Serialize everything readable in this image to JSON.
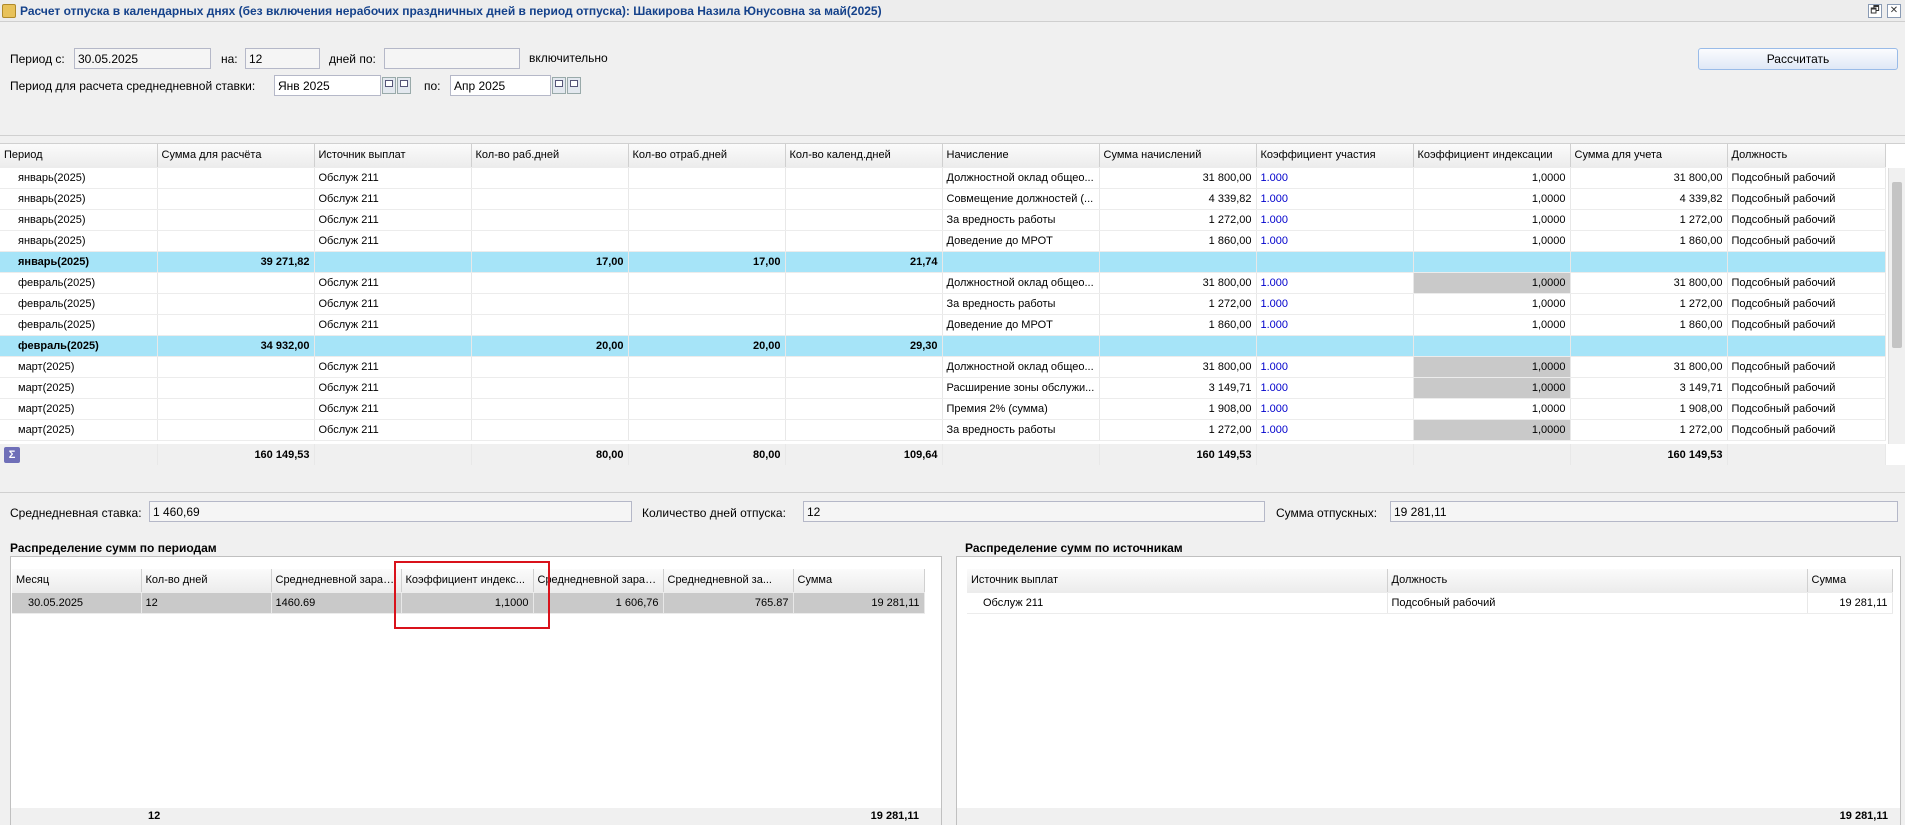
{
  "window": {
    "title": "Расчет отпуска в календарных днях (без включения нерабочих праздничных дней в период отпуска): Шакирова Назила Юнусовна за май(2025)",
    "restore_glyph": "🗗",
    "close_glyph": "✕"
  },
  "params": {
    "period_from_label": "Период с:",
    "period_from_value": "30.05.2025",
    "na_label": "на:",
    "na_value": "12",
    "days_to_label": "дней по:",
    "days_to_value": "",
    "inclusive_label": "включительно",
    "avg_period_label": "Период для расчета среднедневной ставки:",
    "avg_from_value": "Янв 2025",
    "po_label": "по:",
    "avg_to_value": "Апр 2025",
    "calc_button": "Рассчитать"
  },
  "main_grid": {
    "columns": [
      "Период",
      "Сумма для расчёта",
      "Источник выплат",
      "Кол-во раб.дней",
      "Кол-во отраб.дней",
      "Кол-во календ.дней",
      "Начисление",
      "Сумма начислений",
      "Коэффициент участия",
      "Коэффициент индексации",
      "Сумма для учета",
      "Должность"
    ],
    "rows": [
      {
        "type": "row",
        "cells": [
          "январь(2025)",
          "",
          "Обслуж 211",
          "",
          "",
          "",
          "Должностной оклад общео...",
          "31 800,00",
          "1.000",
          "1,0000",
          "31 800,00",
          "Подсобный рабочий"
        ],
        "gray": false
      },
      {
        "type": "row",
        "cells": [
          "январь(2025)",
          "",
          "Обслуж 211",
          "",
          "",
          "",
          "Совмещение должностей (...",
          "4 339,82",
          "1.000",
          "1,0000",
          "4 339,82",
          "Подсобный рабочий"
        ],
        "gray": false
      },
      {
        "type": "row",
        "cells": [
          "январь(2025)",
          "",
          "Обслуж 211",
          "",
          "",
          "",
          "За вредность работы",
          "1 272,00",
          "1.000",
          "1,0000",
          "1 272,00",
          "Подсобный рабочий"
        ],
        "gray": false
      },
      {
        "type": "row",
        "cells": [
          "январь(2025)",
          "",
          "Обслуж 211",
          "",
          "",
          "",
          "Доведение до МРОТ",
          "1 860,00",
          "1.000",
          "1,0000",
          "1 860,00",
          "Подсобный рабочий"
        ],
        "gray": false
      },
      {
        "type": "sub",
        "cells": [
          "январь(2025)",
          "39 271,82",
          "",
          "17,00",
          "17,00",
          "21,74",
          "",
          "",
          "",
          "",
          "",
          ""
        ]
      },
      {
        "type": "row",
        "cells": [
          "февраль(2025)",
          "",
          "Обслуж 211",
          "",
          "",
          "",
          "Должностной оклад общео...",
          "31 800,00",
          "1.000",
          "1,0000",
          "31 800,00",
          "Подсобный рабочий"
        ],
        "gray": true
      },
      {
        "type": "row",
        "cells": [
          "февраль(2025)",
          "",
          "Обслуж 211",
          "",
          "",
          "",
          "За вредность работы",
          "1 272,00",
          "1.000",
          "1,0000",
          "1 272,00",
          "Подсобный рабочий"
        ],
        "gray": false
      },
      {
        "type": "row",
        "cells": [
          "февраль(2025)",
          "",
          "Обслуж 211",
          "",
          "",
          "",
          "Доведение до МРОТ",
          "1 860,00",
          "1.000",
          "1,0000",
          "1 860,00",
          "Подсобный рабочий"
        ],
        "gray": false
      },
      {
        "type": "sub",
        "cells": [
          "февраль(2025)",
          "34 932,00",
          "",
          "20,00",
          "20,00",
          "29,30",
          "",
          "",
          "",
          "",
          "",
          ""
        ]
      },
      {
        "type": "row",
        "cells": [
          "март(2025)",
          "",
          "Обслуж 211",
          "",
          "",
          "",
          "Должностной оклад общео...",
          "31 800,00",
          "1.000",
          "1,0000",
          "31 800,00",
          "Подсобный рабочий"
        ],
        "gray": true
      },
      {
        "type": "row",
        "cells": [
          "март(2025)",
          "",
          "Обслуж 211",
          "",
          "",
          "",
          "Расширение зоны обслужи...",
          "3 149,71",
          "1.000",
          "1,0000",
          "3 149,71",
          "Подсобный рабочий"
        ],
        "gray": true
      },
      {
        "type": "row",
        "cells": [
          "март(2025)",
          "",
          "Обслуж 211",
          "",
          "",
          "",
          "Премия 2% (сумма)",
          "1 908,00",
          "1.000",
          "1,0000",
          "1 908,00",
          "Подсобный рабочий"
        ],
        "gray": false
      },
      {
        "type": "row",
        "cells": [
          "март(2025)",
          "",
          "Обслуж 211",
          "",
          "",
          "",
          "За вредность работы",
          "1 272,00",
          "1.000",
          "1,0000",
          "1 272,00",
          "Подсобный рабочий"
        ],
        "gray": true
      }
    ],
    "totals": {
      "sigma": "Σ",
      "sum_calc": "160 149,53",
      "work_days": "80,00",
      "worked_days": "80,00",
      "cal_days": "109,64",
      "sum_accr": "160 149,53",
      "sum_account": "160 149,53"
    }
  },
  "summary": {
    "avg_rate_label": "Среднедневная ставка:",
    "avg_rate_value": "1 460,69",
    "days_label": "Количество дней отпуска:",
    "days_value": "12",
    "vac_sum_label": "Сумма отпускных:",
    "vac_sum_value": "19 281,11"
  },
  "periods_panel": {
    "title": "Распределение сумм по периодам",
    "columns": [
      "Месяц",
      "Кол-во дней",
      "Среднедневной зараб...",
      "Коэффициент индекс...",
      "Среднедневной зараб...",
      "Среднедневной за...",
      "Сумма"
    ],
    "rows": [
      [
        "30.05.2025",
        "12",
        "1460.69",
        "1,1000",
        "1 606,76",
        "765.87",
        "19 281,11"
      ]
    ],
    "total_days": "12",
    "total_sum": "19 281,11"
  },
  "sources_panel": {
    "title": "Распределение сумм по источникам",
    "columns": [
      "Источник выплат",
      "Должность",
      "Сумма"
    ],
    "rows": [
      [
        "Обслуж 211",
        "Подсобный рабочий",
        "19 281,11"
      ]
    ],
    "total_sum": "19 281,11"
  },
  "colors": {
    "subtotal_row": "#a6e4f8",
    "highlight_box": "#d9121b",
    "title_text": "#15428b",
    "link_blue": "#0000cc"
  }
}
